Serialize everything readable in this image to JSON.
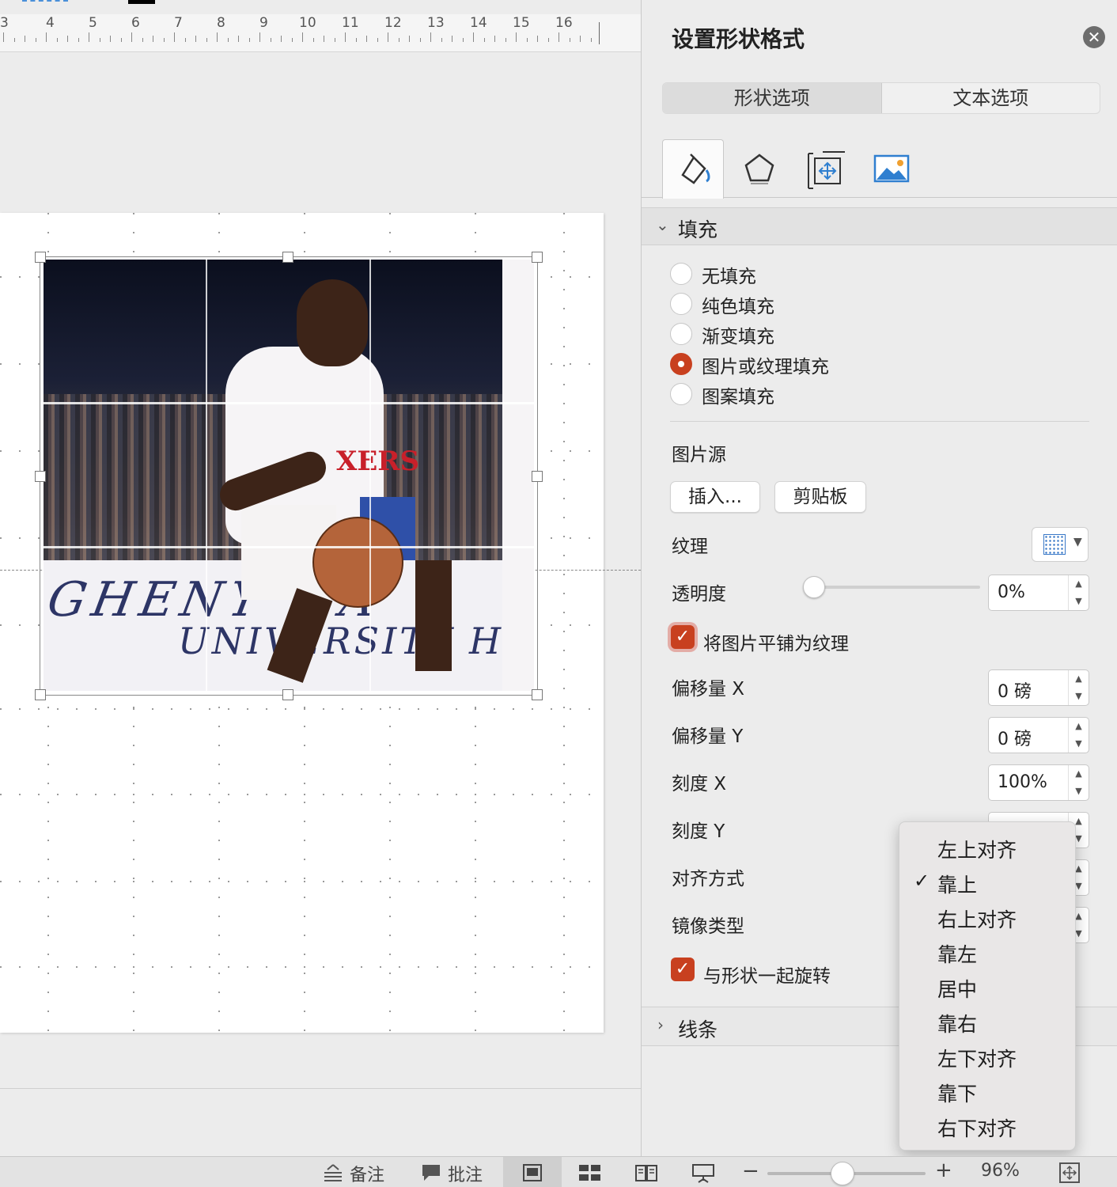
{
  "ruler": {
    "numbers": [
      "3",
      "4",
      "5",
      "6",
      "7",
      "8",
      "9",
      "10",
      "11",
      "12",
      "13",
      "14",
      "15",
      "16"
    ]
  },
  "picture": {
    "jersey_text": "XERS",
    "banner_text_1": "GHENY WA",
    "banner_text_2": "UNIVERSITY HOSP"
  },
  "pane": {
    "title": "设置形状格式",
    "tabs": [
      "形状选项",
      "文本选项"
    ],
    "icon_tabs": [
      "fill-line-icon",
      "shape-effects-icon",
      "size-properties-icon",
      "picture-icon"
    ],
    "fill_section": {
      "label": "填充",
      "options": [
        "无填充",
        "纯色填充",
        "渐变填充",
        "图片或纹理填充",
        "图案填充"
      ],
      "selected": "图片或纹理填充",
      "picture_source_label": "图片源",
      "insert_button": "插入...",
      "clipboard_button": "剪贴板",
      "texture_label": "纹理",
      "transparency_label": "透明度",
      "transparency_value": "0%",
      "transparency_level": 0,
      "tile_checkbox_label": "将图片平铺为纹理",
      "tile_checked": true,
      "offset_x_label": "偏移量 X",
      "offset_x_value": "0 磅",
      "offset_y_label": "偏移量 Y",
      "offset_y_value": "0 磅",
      "scale_x_label": "刻度 X",
      "scale_x_value": "100%",
      "scale_y_label": "刻度 Y",
      "alignment_label": "对齐方式",
      "mirror_label": "镜像类型",
      "rotate_checkbox_label": "与形状一起旋转",
      "rotate_checked": true
    },
    "line_section": {
      "label": "线条"
    }
  },
  "alignment_menu": {
    "items": [
      "左上对齐",
      "靠上",
      "右上对齐",
      "靠左",
      "居中",
      "靠右",
      "左下对齐",
      "靠下",
      "右下对齐"
    ],
    "checked": "靠上",
    "check_glyph": "✓"
  },
  "statusbar": {
    "notes_label": "备注",
    "comments_label": "批注",
    "zoom_value": "96%",
    "zoom_minus": "−",
    "zoom_plus": "+"
  },
  "colors": {
    "accent": "#c8401f",
    "pane_bg": "#ececec"
  }
}
